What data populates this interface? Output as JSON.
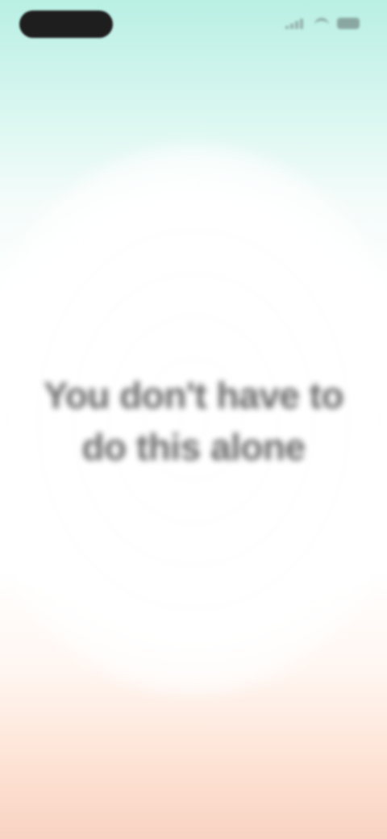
{
  "status_bar": {
    "time": "",
    "signal": "signal-icon",
    "wifi": "wifi-icon",
    "battery": "battery-icon"
  },
  "main": {
    "message": "You don't have to do this alone"
  },
  "colors": {
    "top_gradient": "#b9efe4",
    "bottom_gradient": "#f8d3c3",
    "text": "#2d2d2d",
    "status_pill": "#1e1e1e"
  }
}
